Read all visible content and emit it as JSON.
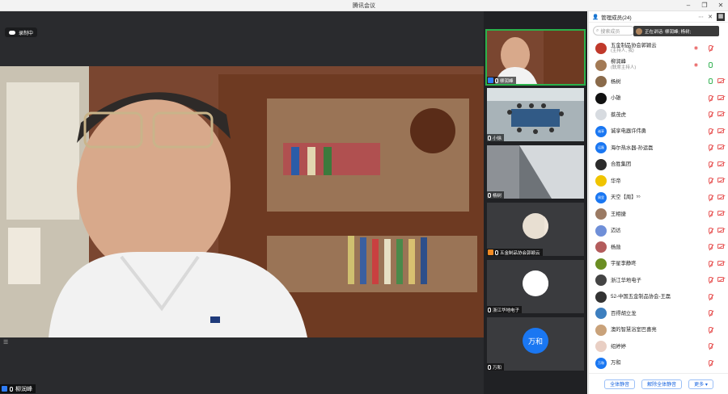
{
  "window": {
    "title": "腾讯会议"
  },
  "stage": {
    "recording_label": "录制中",
    "main_speaker": "柳润峰"
  },
  "thumbnails": [
    {
      "label": "柳润峰",
      "active": true
    },
    {
      "label": "小徐",
      "active": false
    },
    {
      "label": "杨树",
      "active": false
    },
    {
      "label": "五金制品协会郭颖云",
      "active": false
    },
    {
      "label": "浙江华地电子",
      "active": false
    },
    {
      "label": "万和",
      "avatar_text": "万和",
      "active": false
    }
  ],
  "panel": {
    "title": "管理成员(24)",
    "search_placeholder": "搜索成员",
    "speaking_text": "正在讲话: 柳润峰; 杨树;",
    "participants": [
      {
        "name": "五金制品协会郭颖云",
        "sub": "(主持人, 我)",
        "avatar_color": "#c0392b",
        "avatar_text": "",
        "eye": true,
        "mic": "muted",
        "cam": "none"
      },
      {
        "name": "柳润峰",
        "sub": "(联席主持人)",
        "avatar_color": "#a37a55",
        "avatar_text": "",
        "eye": true,
        "mic": "on",
        "cam": "none"
      },
      {
        "name": "杨树",
        "sub": "",
        "avatar_color": "#8a6a4a",
        "avatar_text": "",
        "eye": false,
        "mic": "on",
        "cam": "muted"
      },
      {
        "name": "小雄",
        "sub": "",
        "avatar_color": "#111111",
        "avatar_text": "",
        "eye": false,
        "mic": "muted",
        "cam": "muted"
      },
      {
        "name": "蔡茂虎",
        "sub": "",
        "avatar_color": "#d7dbe0",
        "avatar_text": "",
        "eye": false,
        "mic": "muted",
        "cam": "muted"
      },
      {
        "name": "诚享电器许伟勇",
        "sub": "",
        "avatar_color": "#1a77f2",
        "avatar_text": "诚享",
        "eye": false,
        "mic": "muted",
        "cam": "muted"
      },
      {
        "name": "海尔热水器-孙运磊",
        "sub": "",
        "avatar_color": "#1a77f2",
        "avatar_text": "运磊",
        "eye": false,
        "mic": "muted",
        "cam": "muted"
      },
      {
        "name": "合胜集团",
        "sub": "",
        "avatar_color": "#2b2b2b",
        "avatar_text": "",
        "eye": false,
        "mic": "muted",
        "cam": "muted"
      },
      {
        "name": "华帝",
        "sub": "",
        "avatar_color": "#f0c400",
        "avatar_text": "",
        "eye": false,
        "mic": "muted",
        "cam": "muted"
      },
      {
        "name": "天空【周】⁵⁵",
        "sub": "",
        "avatar_color": "#1a77f2",
        "avatar_text": "周里",
        "eye": false,
        "mic": "muted",
        "cam": "muted"
      },
      {
        "name": "王相捷",
        "sub": "",
        "avatar_color": "#9b7a63",
        "avatar_text": "",
        "eye": false,
        "mic": "muted",
        "cam": "muted"
      },
      {
        "name": "迈达",
        "sub": "",
        "avatar_color": "#6f8fd8",
        "avatar_text": "",
        "eye": false,
        "mic": "muted",
        "cam": "muted"
      },
      {
        "name": "杨勋",
        "sub": "",
        "avatar_color": "#b35c5c",
        "avatar_text": "",
        "eye": false,
        "mic": "muted",
        "cam": "muted"
      },
      {
        "name": "宇星李静咚",
        "sub": "",
        "avatar_color": "#6b8e23",
        "avatar_text": "",
        "eye": false,
        "mic": "muted",
        "cam": "muted"
      },
      {
        "name": "浙江华地电子",
        "sub": "",
        "avatar_color": "#444444",
        "avatar_text": "",
        "eye": false,
        "mic": "muted",
        "cam": "muted"
      },
      {
        "name": "52-中国五金制品协会-王磊",
        "sub": "",
        "avatar_color": "#333333",
        "avatar_text": "",
        "eye": false,
        "mic": "muted",
        "cam": "none"
      },
      {
        "name": "百得胡立龙",
        "sub": "",
        "avatar_color": "#3d7fbf",
        "avatar_text": "",
        "eye": false,
        "mic": "muted",
        "cam": "none"
      },
      {
        "name": "澳的智慧浴室巴喜亮",
        "sub": "",
        "avatar_color": "#c9a27a",
        "avatar_text": "",
        "eye": false,
        "mic": "muted",
        "cam": "none"
      },
      {
        "name": "绍婷婷",
        "sub": "",
        "avatar_color": "#e9cfc4",
        "avatar_text": "",
        "eye": false,
        "mic": "muted",
        "cam": "none"
      },
      {
        "name": "万和",
        "sub": "",
        "avatar_color": "#1a77f2",
        "avatar_text": "万和",
        "eye": false,
        "mic": "muted",
        "cam": "none"
      }
    ],
    "footer": {
      "mute_all": "全体静音",
      "unmute_all": "解除全体静音",
      "more": "更多 ▾"
    }
  }
}
